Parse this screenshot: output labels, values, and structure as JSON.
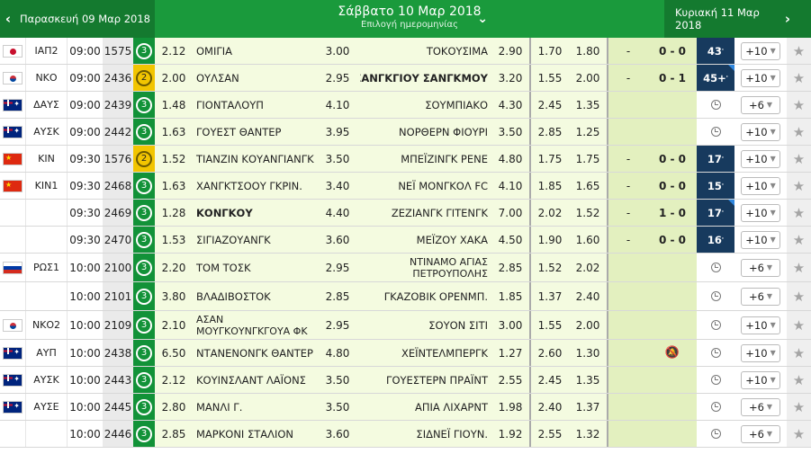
{
  "header": {
    "prev_label": "Παρασκευή 09 Μαρ 2018",
    "next_label": "Κυριακή 11 Μαρ 2018",
    "title": "Σάββατο 10 Μαρ 2018",
    "subtitle": "Επιλογή ημερομηνίας",
    "prev_arrow": "‹",
    "next_arrow": "›",
    "dropdown_arrow": "⌄"
  },
  "icons": {
    "min_bet": "circled-number-icon",
    "clock": "clock-icon",
    "notification_off": "bell-off-icon",
    "favorite": "star-icon",
    "dropdown": "chevron-down-icon"
  },
  "colors": {
    "header_green": "#1a9a3c",
    "min_bet_green": "#129238",
    "min_bet_yellow": "#f2c500",
    "live_navy": "#173a5e",
    "odds_bg": "#f4fbe0"
  },
  "rows": [
    {
      "flag": "jp",
      "league": "ΙΑΠ2",
      "time": "09:00",
      "code": "1575",
      "min_bet": "3",
      "min_bet_color": "green",
      "odd1": "2.12",
      "home": "ΟΜΙΓΙΑ",
      "oddx": "3.00",
      "away": "ΤΟΚΟΥΣΙΜΑ",
      "odd2": "2.90",
      "under": "1.70",
      "over": "1.80",
      "ht": "-",
      "score": "0 - 0",
      "minute": "43",
      "more": "+10",
      "star": "★"
    },
    {
      "flag": "kr",
      "league": "ΝΚΟ",
      "time": "09:00",
      "code": "2436",
      "min_bet": "2",
      "min_bet_color": "yellow",
      "odd1": "2.00",
      "home": "ΟΥΛΣΑΝ",
      "oddx": "2.95",
      "away": "ΣΑΝΓΚΓΙΟΥ ΣΑΝΓΚΜΟΥ",
      "away_bold": true,
      "odd2": "3.20",
      "under": "1.55",
      "over": "2.00",
      "ht": "-",
      "score": "0 - 1",
      "minute": "45+",
      "more": "+10",
      "star": "★",
      "corner": true
    },
    {
      "flag": "au",
      "league": "ΔΑΥΣ",
      "time": "09:00",
      "code": "2439",
      "min_bet": "3",
      "min_bet_color": "green",
      "odd1": "1.48",
      "home": "ΓΙΟΝΤΑΛΟΥΠ",
      "oddx": "4.10",
      "away": "ΣΟΥΜΠΙΑΚΟ",
      "odd2": "4.30",
      "under": "2.45",
      "over": "1.35",
      "ht": "",
      "score": "",
      "minute": "",
      "more": "+6",
      "star": "★"
    },
    {
      "flag": "au",
      "league": "ΑΥΣΚ",
      "time": "09:00",
      "code": "2442",
      "min_bet": "3",
      "min_bet_color": "green",
      "odd1": "1.63",
      "home": "ΓΟΥΕΣΤ ΘΑΝΤΕΡ",
      "oddx": "3.95",
      "away": "ΝΟΡΘΕΡΝ ΦΙΟΥΡΙ",
      "odd2": "3.50",
      "under": "2.85",
      "over": "1.25",
      "ht": "",
      "score": "",
      "minute": "",
      "more": "+10",
      "star": "★"
    },
    {
      "flag": "cn",
      "league": "ΚΙΝ",
      "time": "09:30",
      "code": "1576",
      "min_bet": "2",
      "min_bet_color": "yellow",
      "odd1": "1.52",
      "home": "ΤΙΑΝΖΙΝ ΚΟΥΑΝΓΙΑΝΓΚ",
      "oddx": "3.50",
      "away": "ΜΠΕΪΖΙΝΓΚ ΡΕΝΕ",
      "odd2": "4.80",
      "under": "1.75",
      "over": "1.75",
      "ht": "-",
      "score": "0 - 0",
      "minute": "17",
      "more": "+10",
      "star": "★"
    },
    {
      "flag": "cn",
      "league": "ΚΙΝ1",
      "time": "09:30",
      "code": "2468",
      "min_bet": "3",
      "min_bet_color": "green",
      "odd1": "1.63",
      "home": "ΧΑΝΓΚΤΣΟΟΥ ΓΚΡΙΝ.",
      "oddx": "3.40",
      "away": "ΝΕΪ ΜΟΝΓΚΟΛ FC",
      "odd2": "4.10",
      "under": "1.85",
      "over": "1.65",
      "ht": "-",
      "score": "0 - 0",
      "minute": "15",
      "more": "+10",
      "star": "★"
    },
    {
      "flag": "",
      "league": "",
      "time": "09:30",
      "code": "2469",
      "min_bet": "3",
      "min_bet_color": "green",
      "odd1": "1.28",
      "home": "ΚΟΝΓΚΟΥ",
      "home_bold": true,
      "oddx": "4.40",
      "away": "ΖΕΖΙΑΝΓΚ ΓΙΤΕΝΓΚ",
      "odd2": "7.00",
      "under": "2.02",
      "over": "1.52",
      "ht": "-",
      "score": "1 - 0",
      "minute": "17",
      "more": "+10",
      "star": "★",
      "corner": true
    },
    {
      "flag": "",
      "league": "",
      "time": "09:30",
      "code": "2470",
      "min_bet": "3",
      "min_bet_color": "green",
      "odd1": "1.53",
      "home": "ΣΙΓΙΑΖΟΥΑΝΓΚ",
      "oddx": "3.60",
      "away": "ΜΕΪΖΟΥ ΧΑΚΑ",
      "odd2": "4.50",
      "under": "1.90",
      "over": "1.60",
      "ht": "-",
      "score": "0 - 0",
      "minute": "16",
      "more": "+10",
      "star": "★"
    },
    {
      "flag": "ru",
      "league": "ΡΩΣ1",
      "time": "10:00",
      "code": "2100",
      "min_bet": "3",
      "min_bet_color": "green",
      "odd1": "2.20",
      "home": "ΤΟΜ ΤΟΣΚ",
      "oddx": "2.95",
      "away": "ΝΤΙΝΑΜΟ ΑΓΙΑΣ ΠΕΤΡΟΥΠΟΛΗΣ",
      "away_two_line": true,
      "odd2": "2.85",
      "under": "1.52",
      "over": "2.02",
      "ht": "",
      "score": "",
      "minute": "",
      "more": "+6",
      "star": "★",
      "tall": true
    },
    {
      "flag": "",
      "league": "",
      "time": "10:00",
      "code": "2101",
      "min_bet": "3",
      "min_bet_color": "green",
      "odd1": "3.80",
      "home": "ΒΛΑΔΙΒΟΣΤΟΚ",
      "oddx": "2.85",
      "away": "ΓΚΑΖΟΒΙΚ ΟΡΕΝΜΠ.",
      "odd2": "1.85",
      "under": "1.37",
      "over": "2.40",
      "ht": "",
      "score": "",
      "minute": "",
      "more": "+6",
      "star": "★",
      "tall": true
    },
    {
      "flag": "kr",
      "league": "ΝΚΟ2",
      "time": "10:00",
      "code": "2109",
      "min_bet": "3",
      "min_bet_color": "green",
      "odd1": "2.10",
      "home": "ΑΣΑΝ ΜΟΥΓΚΟΥΝΓΚΓΟΥΑ ΦΚ",
      "home_two_line": true,
      "oddx": "2.95",
      "away": "ΣΟΥΟΝ ΣΙΤΙ",
      "odd2": "3.00",
      "under": "1.55",
      "over": "2.00",
      "ht": "",
      "score": "",
      "minute": "",
      "more": "+10",
      "star": "★",
      "tall": true
    },
    {
      "flag": "au",
      "league": "ΑΥΠ",
      "time": "10:00",
      "code": "2438",
      "min_bet": "3",
      "min_bet_color": "green",
      "odd1": "6.50",
      "home": "ΝΤΑΝΕΝΟΝΓΚ ΘΑΝΤΕΡ",
      "oddx": "4.80",
      "away": "ΧΕΪΝΤΕΛΜΠΕΡΓΚ",
      "odd2": "1.27",
      "under": "2.60",
      "over": "1.30",
      "ht": "",
      "score": "bell-off",
      "minute": "",
      "more": "+10",
      "star": "★"
    },
    {
      "flag": "au",
      "league": "ΑΥΣΚ",
      "time": "10:00",
      "code": "2443",
      "min_bet": "3",
      "min_bet_color": "green",
      "odd1": "2.12",
      "home": "ΚΟΥΙΝΣΛΑΝΤ ΛΑΪΟΝΣ",
      "oddx": "3.50",
      "away": "ΓΟΥΕΣΤΕΡΝ ΠΡΑΪΝΤ",
      "odd2": "2.55",
      "under": "2.45",
      "over": "1.35",
      "ht": "",
      "score": "",
      "minute": "",
      "more": "+10",
      "star": "★"
    },
    {
      "flag": "au",
      "league": "ΑΥΣΕ",
      "time": "10:00",
      "code": "2445",
      "min_bet": "3",
      "min_bet_color": "green",
      "odd1": "2.80",
      "home": "ΜΑΝΛΙ Γ.",
      "oddx": "3.50",
      "away": "ΑΠΙΑ ΛΙΧΑΡΝΤ",
      "odd2": "1.98",
      "under": "2.40",
      "over": "1.37",
      "ht": "",
      "score": "",
      "minute": "",
      "more": "+6",
      "star": "★"
    },
    {
      "flag": "",
      "league": "",
      "time": "10:00",
      "code": "2446",
      "min_bet": "3",
      "min_bet_color": "green",
      "odd1": "2.85",
      "home": "ΜΑΡΚΟΝΙ ΣΤΑΛΙΟΝ",
      "oddx": "3.60",
      "away": "ΣΙΔΝΕΪ ΓΙΟΥΝ.",
      "odd2": "1.92",
      "under": "2.55",
      "over": "1.32",
      "ht": "",
      "score": "",
      "minute": "",
      "more": "+6",
      "star": "★"
    }
  ]
}
